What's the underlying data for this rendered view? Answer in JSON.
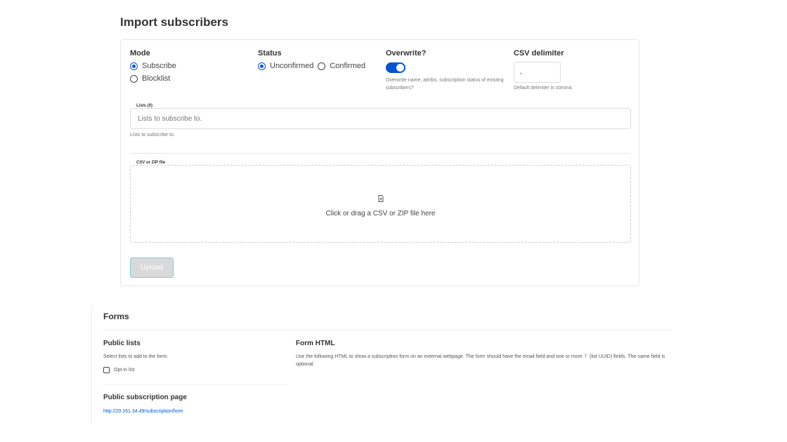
{
  "import": {
    "title": "Import subscribers",
    "mode": {
      "label": "Mode",
      "options": [
        "Subscribe",
        "Blocklist"
      ],
      "selected": "Subscribe"
    },
    "status": {
      "label": "Status",
      "options": [
        "Unconfirmed",
        "Confirmed"
      ],
      "selected": "Unconfirmed"
    },
    "overwrite": {
      "label": "Overwrite?",
      "enabled": true,
      "help": "Overwrite name, attribs, subscription status of existing subscribers?"
    },
    "delimiter": {
      "label": "CSV delimiter",
      "value": ",",
      "help": "Default delimiter is comma."
    },
    "lists": {
      "legend": "Lists (0)",
      "placeholder": "Lists to subscribe to.",
      "help": "Lists to subscribe to."
    },
    "file": {
      "legend": "CSV or ZIP file",
      "prompt": "Click or drag a CSV or ZIP file here",
      "icon": "file-upload-icon"
    },
    "upload_label": "Upload"
  },
  "forms": {
    "title": "Forms",
    "public_lists": {
      "title": "Public lists",
      "help": "Select lists to add to the form.",
      "items": [
        "Opt-in list"
      ]
    },
    "form_html": {
      "title": "Form HTML",
      "help": "Use the following HTML to show a subscription form on an external webpage. The form should have the email field and one or more `l` (list UUID) fields. The name field is optional."
    },
    "public_page": {
      "title": "Public subscription page",
      "url": "http://20.161.34.49/subscription/form"
    }
  },
  "colors": {
    "accent": "#0055d4",
    "upload_border": "#7dd3d0"
  }
}
